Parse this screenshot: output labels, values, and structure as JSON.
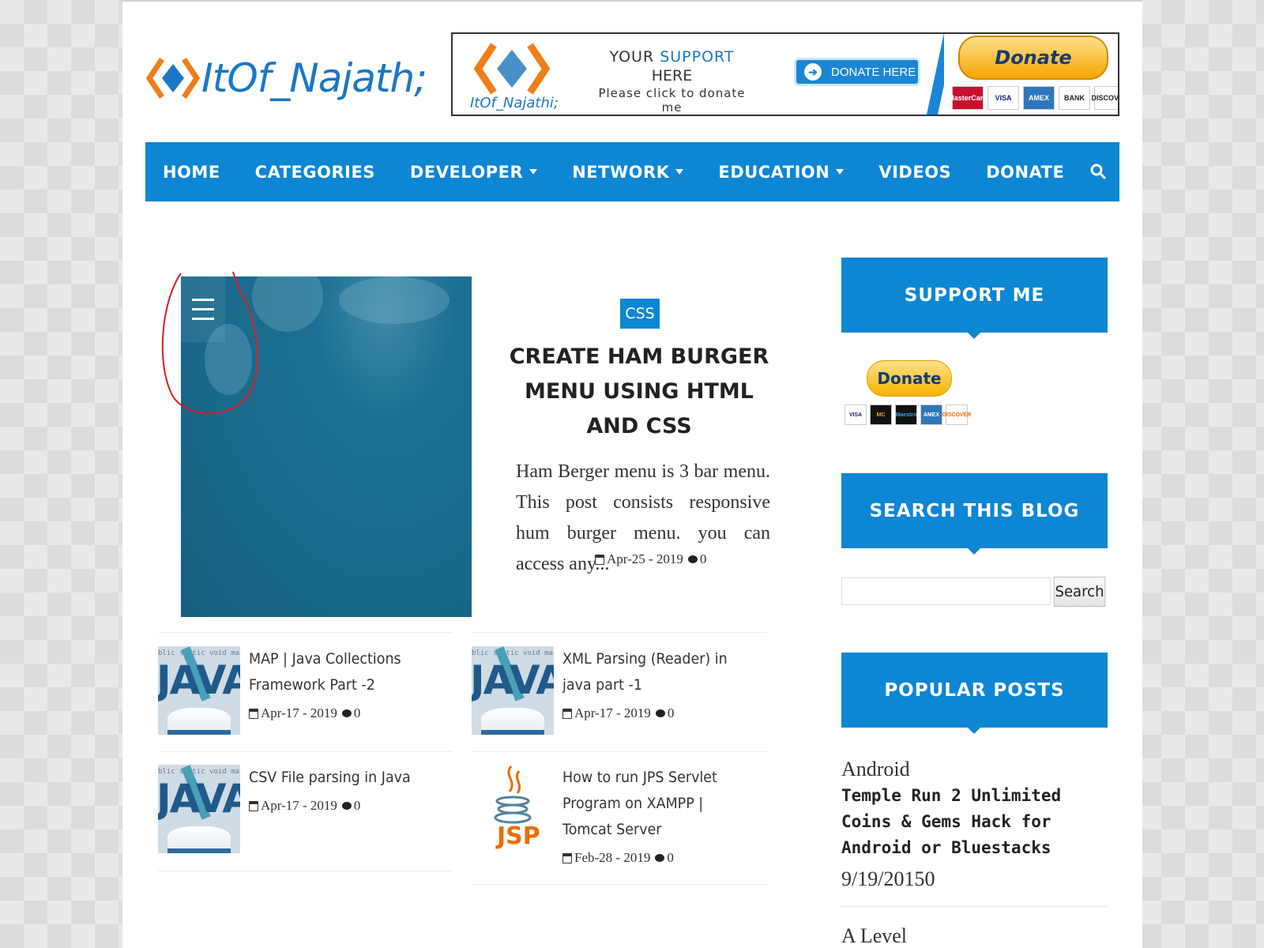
{
  "site": {
    "logo_text": "ItOf_Najath;",
    "brand_color": "#1b77c5",
    "accent_color": "#0d86d4"
  },
  "banner": {
    "brand": "ItOf_Najathi;",
    "support_prefix": "YOUR ",
    "support_highlight": "SUPPORT",
    "support_line2": "HERE",
    "support_line3": "Please click to donate me",
    "donate_here_label": "DONATE HERE",
    "donate_label": "Donate",
    "cards": [
      "MasterCard",
      "VISA",
      "AMEX",
      "BANK",
      "DISCOVER"
    ]
  },
  "nav": {
    "items": [
      {
        "label": "HOME",
        "has_dropdown": false
      },
      {
        "label": "CATEGORIES",
        "has_dropdown": false
      },
      {
        "label": "DEVELOPER",
        "has_dropdown": true
      },
      {
        "label": "NETWORK",
        "has_dropdown": true
      },
      {
        "label": "EDUCATION",
        "has_dropdown": true
      },
      {
        "label": "VIDEOS",
        "has_dropdown": false
      },
      {
        "label": "DONATE",
        "has_dropdown": false
      }
    ],
    "search_icon": "search-icon"
  },
  "featured": {
    "tag": "CSS",
    "title": "CREATE HAM BURGER MENU USING HTML AND CSS",
    "excerpt": "Ham Berger menu is 3 bar menu. This post consists responsive hum burger menu. you can access any...",
    "date": "Apr-25 - 2019",
    "comments": "0"
  },
  "posts": [
    {
      "title": "MAP | Java Collections Framework Part -2",
      "date": "Apr-17 - 2019",
      "comments": "0",
      "thumb": "java"
    },
    {
      "title": "XML Parsing (Reader) in java part -1",
      "date": "Apr-17 - 2019",
      "comments": "0",
      "thumb": "java"
    },
    {
      "title": "CSV File parsing in Java",
      "date": "Apr-17 - 2019",
      "comments": "0",
      "thumb": "java"
    },
    {
      "title": "How to run JPS Servlet Program on XAMPP | Tomcat Server",
      "date": "Feb-28 - 2019",
      "comments": "0",
      "thumb": "jsp"
    }
  ],
  "thumbs": {
    "java_code": "blic static void main(Str",
    "java_word": "JAVA",
    "jsp_word": "JSP"
  },
  "sidebar": {
    "support_title": "SUPPORT ME",
    "donate_label": "Donate",
    "cards": [
      "VISA",
      "MC",
      "Maestro",
      "AMEX",
      "DISCOVER"
    ],
    "search_title": "SEARCH THIS BLOG",
    "search_button": "Search",
    "search_value": "",
    "popular_title": "POPULAR POSTS",
    "popular": [
      {
        "category": "Android",
        "title": "Temple Run 2 Unlimited Coins & Gems Hack for Android or Bluestacks",
        "date": "9/19/20150"
      },
      {
        "category": "A Level"
      }
    ]
  }
}
